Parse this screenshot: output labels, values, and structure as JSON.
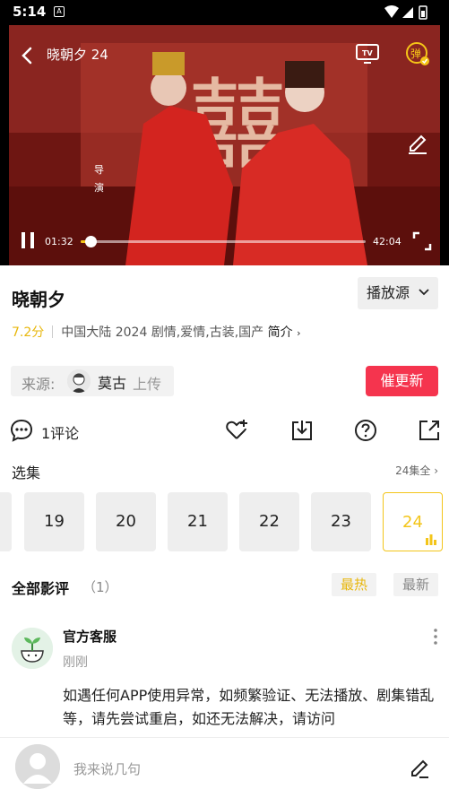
{
  "status_bar": {
    "time": "5:14",
    "notification": "A"
  },
  "player": {
    "title": "晓朝夕 24",
    "current_time": "01:32",
    "duration": "42:04",
    "progress": 0.036,
    "icons": [
      "back-icon",
      "cast-tv-icon",
      "danmu-icon",
      "edit-danmu-icon",
      "pause-icon",
      "fullscreen-icon"
    ],
    "danmu_label": "弹",
    "accent": "#f5c518"
  },
  "show": {
    "title": "晓朝夕",
    "source_button": "播放源",
    "rating": "7.2分",
    "region": "中国大陆",
    "year": "2024",
    "genres": "剧情,爱情,古装,国产",
    "intro_link": "简介"
  },
  "uploader": {
    "label": "来源:",
    "name": "莫古",
    "action": "上传"
  },
  "urge_button": "催更新",
  "actions": {
    "comment_count": "1评论"
  },
  "episodes": {
    "heading": "选集",
    "all_label": "24集全",
    "items": [
      "19",
      "20",
      "21",
      "22",
      "23",
      "24"
    ],
    "current": "24"
  },
  "reviews": {
    "heading": "全部影评",
    "count": "（1）",
    "sort_hot": "最热",
    "sort_new": "最新",
    "items": [
      {
        "author": "官方客服",
        "time": "刚刚",
        "text": "如遇任何APP使用异常，如频繁验证、无法播放、剧集错乱等，请先尝试重启，如还无法解决，请访问"
      }
    ]
  },
  "bottom": {
    "comment_placeholder": "我来说几句"
  },
  "colors": {
    "rating": "#e8b70c",
    "urge": "#f5344e",
    "active_episode": "#f3c51a"
  }
}
